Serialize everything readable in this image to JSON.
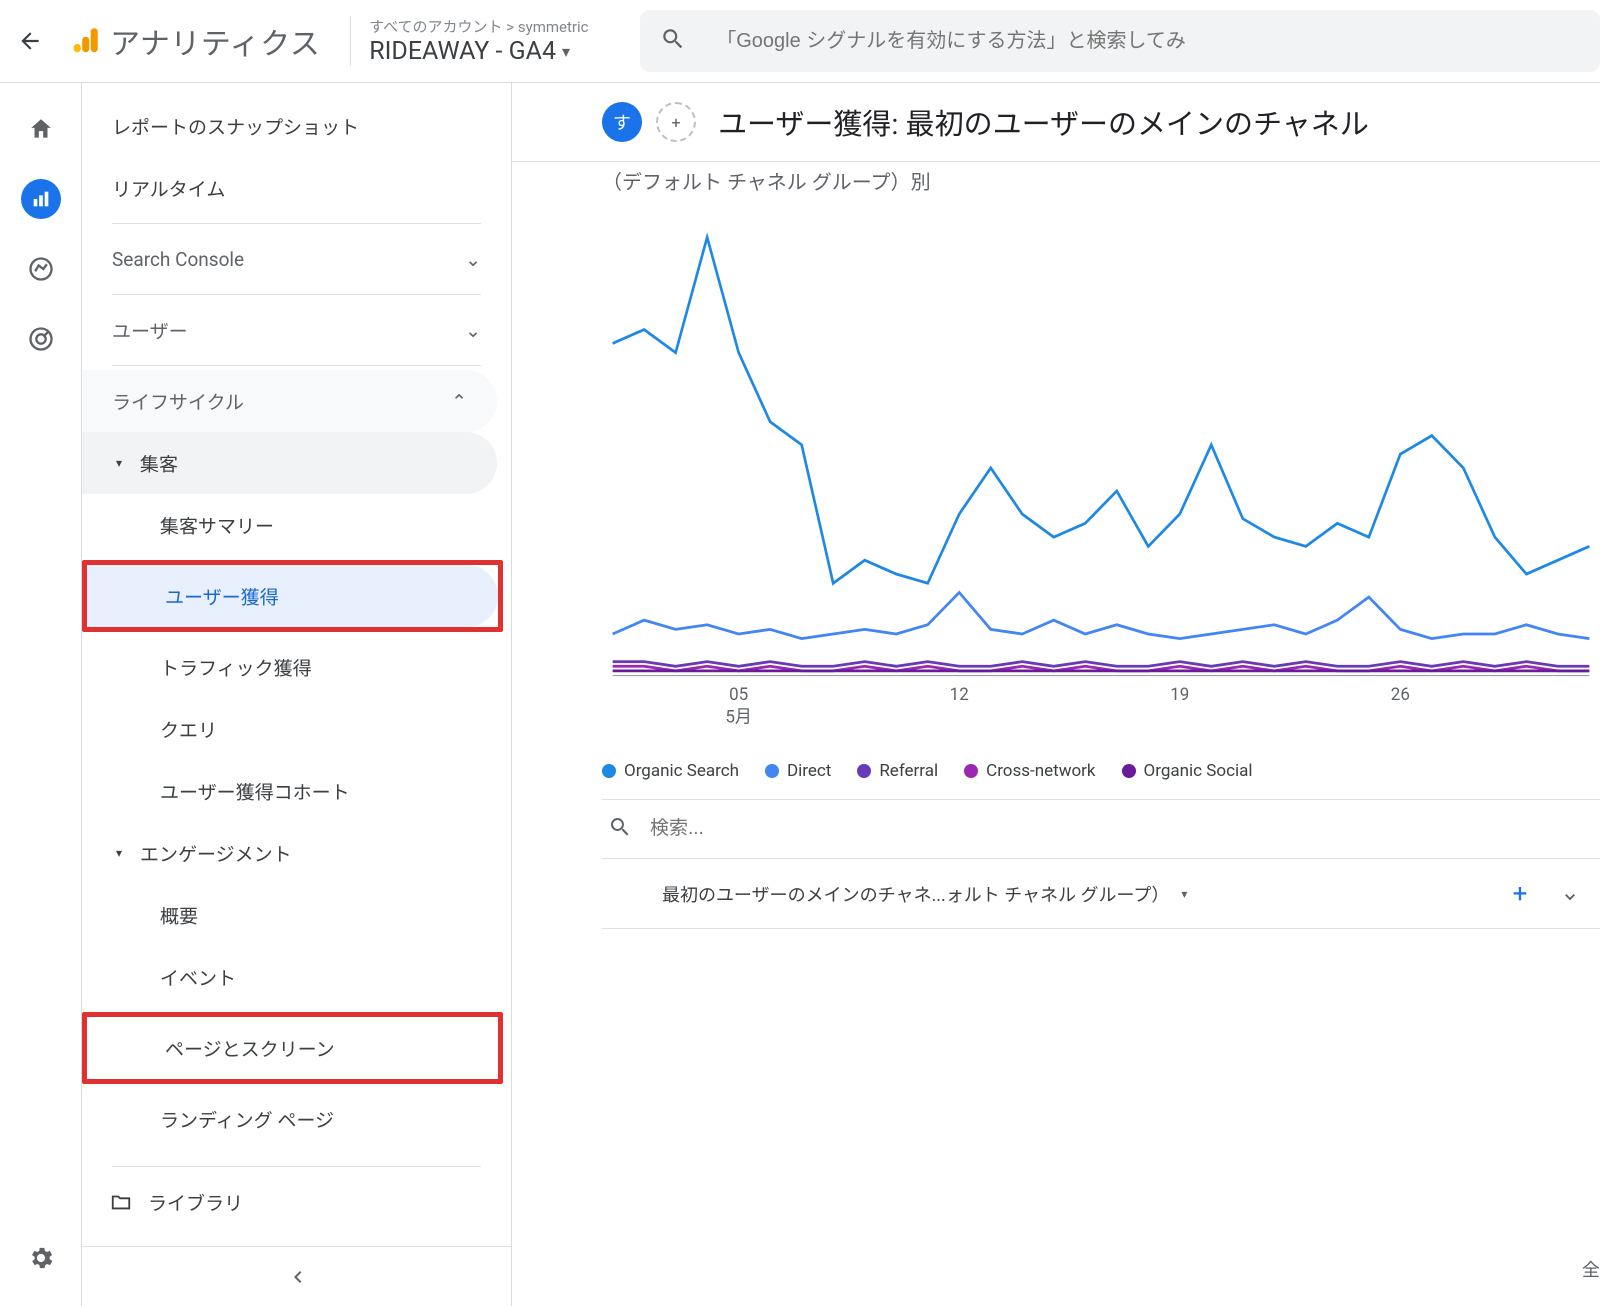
{
  "header": {
    "brand": "アナリティクス",
    "account_path_prefix": "すべてのアカウント",
    "account_path_sep": ">",
    "account_name": "symmetric",
    "property_name": "RIDEAWAY - GA4",
    "search_placeholder": "「Google シグナルを有効にする方法」と検索してみ"
  },
  "sidebar": {
    "snapshot": "レポートのスナップショット",
    "realtime": "リアルタイム",
    "search_console": "Search Console",
    "user": "ユーザー",
    "lifecycle": "ライフサイクル",
    "acq": "集客",
    "acq_summary": "集客サマリー",
    "acq_user": "ユーザー獲得",
    "acq_traffic": "トラフィック獲得",
    "acq_query": "クエリ",
    "acq_cohort": "ユーザー獲得コホート",
    "eng": "エンゲージメント",
    "eng_overview": "概要",
    "eng_events": "イベント",
    "eng_pages": "ページとスクリーン",
    "eng_landing": "ランディング ページ",
    "library": "ライブラリ"
  },
  "page": {
    "chip": "す",
    "title": "ユーザー獲得: 最初のユーザーのメインのチャネル",
    "subtitle": "（デフォルト チャネル グループ）別",
    "search_placeholder": "検索...",
    "dimension_label": "最初のユーザーのメインのチャネ...ォルト チャネル グループ）",
    "footer_note_prefix": "全"
  },
  "chart_data": {
    "type": "line",
    "x_ticks": [
      "05",
      "12",
      "19",
      "26"
    ],
    "x_month_label": "5月",
    "y_range": [
      0,
      100
    ],
    "series": [
      {
        "name": "Organic Search",
        "color": "#1e88e5",
        "values": [
          72,
          75,
          70,
          95,
          70,
          55,
          50,
          20,
          25,
          22,
          20,
          35,
          45,
          35,
          30,
          33,
          40,
          28,
          35,
          50,
          34,
          30,
          28,
          33,
          30,
          48,
          52,
          45,
          30,
          22,
          25,
          28
        ]
      },
      {
        "name": "Direct",
        "color": "#4285f4",
        "values": [
          9,
          12,
          10,
          11,
          9,
          10,
          8,
          9,
          10,
          9,
          11,
          18,
          10,
          9,
          12,
          9,
          11,
          9,
          8,
          9,
          10,
          11,
          9,
          12,
          17,
          10,
          8,
          9,
          9,
          11,
          9,
          8
        ]
      },
      {
        "name": "Referral",
        "color": "#673ab7",
        "values": [
          3,
          3,
          2,
          3,
          2,
          3,
          2,
          2,
          3,
          2,
          3,
          2,
          2,
          3,
          2,
          3,
          2,
          2,
          3,
          2,
          3,
          2,
          3,
          2,
          2,
          3,
          2,
          3,
          2,
          3,
          2,
          2
        ]
      },
      {
        "name": "Cross-network",
        "color": "#9c27b0",
        "values": [
          2,
          2,
          1,
          2,
          1,
          2,
          1,
          1,
          2,
          1,
          2,
          1,
          1,
          2,
          1,
          2,
          1,
          1,
          2,
          1,
          2,
          1,
          2,
          1,
          1,
          2,
          1,
          2,
          1,
          2,
          1,
          1
        ]
      },
      {
        "name": "Organic Social",
        "color": "#6a1b9a",
        "values": [
          1,
          1,
          1,
          1,
          1,
          1,
          1,
          1,
          1,
          1,
          1,
          1,
          1,
          1,
          1,
          1,
          1,
          1,
          1,
          1,
          1,
          1,
          1,
          1,
          1,
          1,
          1,
          1,
          1,
          1,
          1,
          1
        ]
      }
    ]
  }
}
